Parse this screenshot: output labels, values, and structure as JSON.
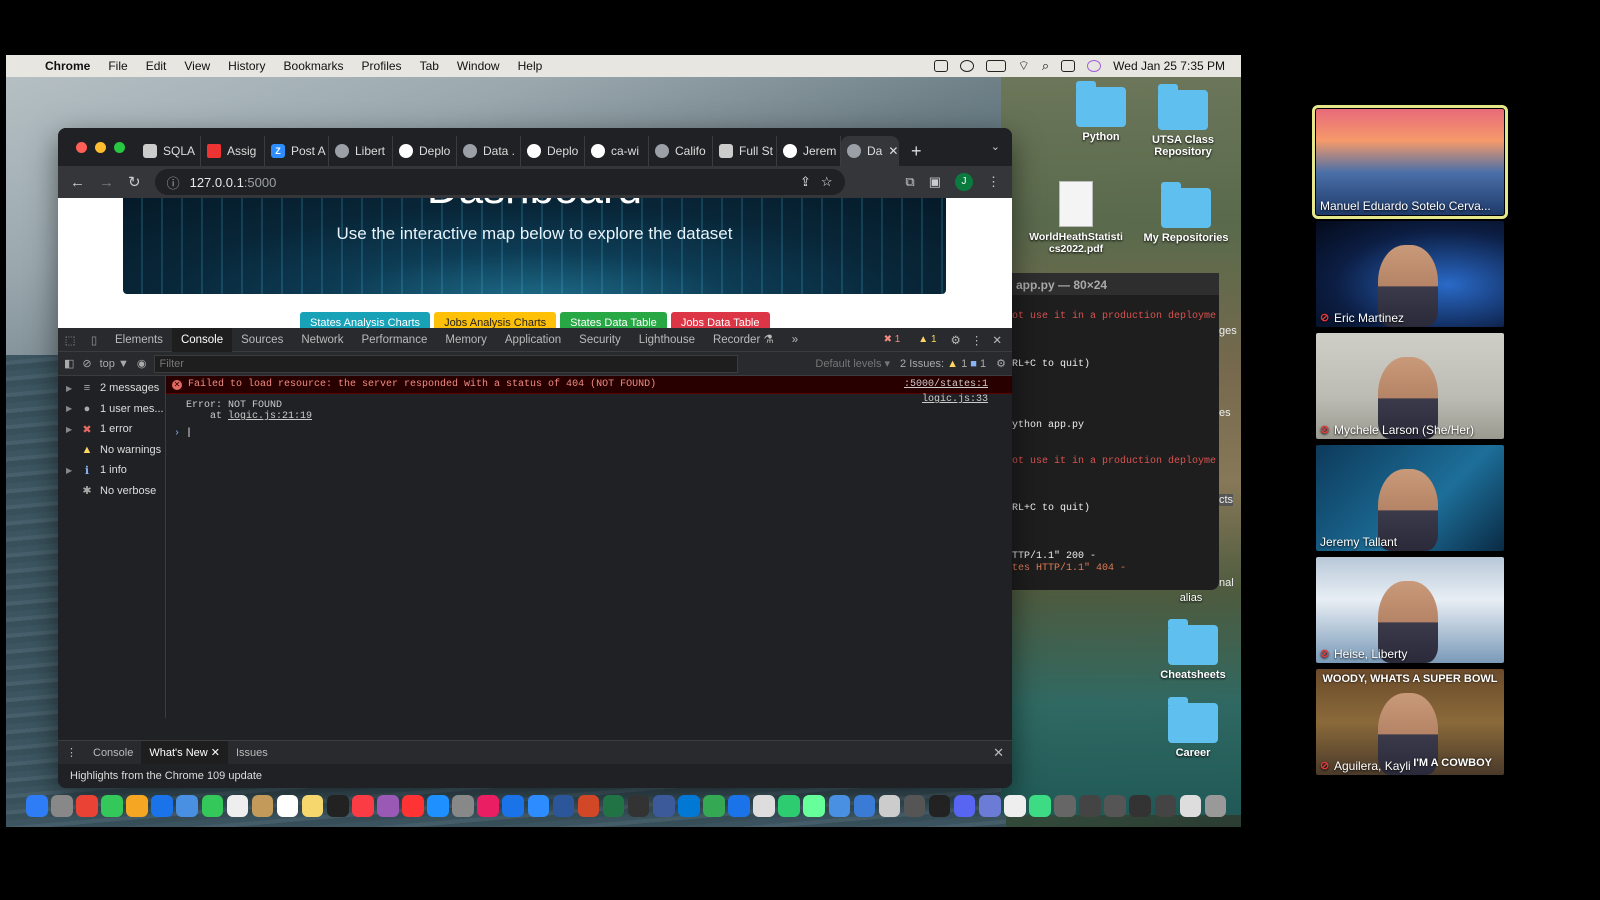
{
  "menubar": {
    "app": "Chrome",
    "items": [
      "File",
      "Edit",
      "View",
      "History",
      "Bookmarks",
      "Profiles",
      "Tab",
      "Window",
      "Help"
    ],
    "datetime": "Wed Jan 25  7:35 PM"
  },
  "desktop": {
    "icons": [
      {
        "label": "Python",
        "kind": "folder"
      },
      {
        "label": "UTSA Class Repository",
        "kind": "folder"
      },
      {
        "label": "WorldHeathStatistics2022.pdf",
        "kind": "doc"
      },
      {
        "label": "My Repositories",
        "kind": "folder"
      },
      {
        "label": "alias",
        "kind": "text"
      },
      {
        "label": "Cheatsheets",
        "kind": "folder"
      },
      {
        "label": "Career",
        "kind": "folder"
      }
    ],
    "edge_labels": [
      "ges",
      "es",
      "cts",
      "nal"
    ]
  },
  "terminal": {
    "title": "app.py — 80×24",
    "lines": [
      "ot use it in a production deployme",
      "RL+C to quit)",
      "ython app.py",
      "ot use it in a production deployme",
      "RL+C to quit)",
      "TTP/1.1\" 200 -",
      "tes HTTP/1.1\" 404 -"
    ]
  },
  "chrome": {
    "tabs": [
      {
        "label": "SQLA",
        "fav": "sq"
      },
      {
        "label": "Assig",
        "fav": "red"
      },
      {
        "label": "Post A",
        "fav": "z"
      },
      {
        "label": "Libert",
        "fav": "globe"
      },
      {
        "label": "Deplo",
        "fav": "gh"
      },
      {
        "label": "Data .",
        "fav": "globe"
      },
      {
        "label": "Deplo",
        "fav": "gh"
      },
      {
        "label": "ca-wi",
        "fav": "gh"
      },
      {
        "label": "Califo",
        "fav": "globe"
      },
      {
        "label": "Full St",
        "fav": "sq"
      },
      {
        "label": "Jerem",
        "fav": "gh"
      }
    ],
    "active_tab": "Da",
    "url": "127.0.0.1",
    "url_port": ":5000",
    "avatar_initial": "J"
  },
  "page": {
    "hero_title": "Dashboard",
    "hero_subtitle": "Use the interactive map below to explore the dataset",
    "buttons": [
      {
        "label": "States Analysis Charts",
        "color": "#17a2b8"
      },
      {
        "label": "Jobs Analysis Charts",
        "color": "#ffc107"
      },
      {
        "label": "States Data Table",
        "color": "#28a745"
      },
      {
        "label": "Jobs Data Table",
        "color": "#dc3545"
      }
    ]
  },
  "devtools": {
    "tabs": [
      "Elements",
      "Console",
      "Sources",
      "Network",
      "Performance",
      "Memory",
      "Application",
      "Security",
      "Lighthouse",
      "Recorder ⚗"
    ],
    "active_tab": "Console",
    "more": "»",
    "error_count": "1",
    "warn_count": "1",
    "context": "top ▼",
    "filter_placeholder": "Filter",
    "levels": "Default levels ▾",
    "issues_label": "2 Issues:",
    "issues_warn": "1",
    "issues_info": "1",
    "sidebar": [
      {
        "label": "2 messages",
        "icon": "≡",
        "color": "#aaa",
        "arrow": true
      },
      {
        "label": "1 user mes...",
        "icon": "●",
        "color": "#aaa",
        "arrow": true
      },
      {
        "label": "1 error",
        "icon": "✖",
        "color": "#e46962",
        "arrow": true
      },
      {
        "label": "No warnings",
        "icon": "▲",
        "color": "#fdd663",
        "arrow": false
      },
      {
        "label": "1 info",
        "icon": "ℹ",
        "color": "#8ab4f8",
        "arrow": true
      },
      {
        "label": "No verbose",
        "icon": "✱",
        "color": "#aaa",
        "arrow": false
      }
    ],
    "error_message": "Failed to load resource: the server responded with a status of 404 (NOT FOUND)",
    "error_source": ":5000/states:1",
    "error_detail": "Error: NOT FOUND",
    "error_at": "    at ",
    "error_at_link": "logic.js:21:19",
    "error_detail_source": "logic.js:33",
    "drawer_tabs": [
      "Console",
      "What's New",
      "Issues"
    ],
    "drawer_active": "What's New",
    "whats_new_text": "Highlights from the Chrome 109 update"
  },
  "dock_colors": [
    "#2e7cf6",
    "#888",
    "#ea4335",
    "#34c759",
    "#f5a623",
    "#1a73e8",
    "#4a90e2",
    "#34c759",
    "#eee",
    "#c49a5a",
    "#fff",
    "#f5d76e",
    "#222",
    "#fc3c44",
    "#9b59b6",
    "#f33",
    "#1e90ff",
    "#888",
    "#e91e63",
    "#1a73e8",
    "#2d8cff",
    "#2b579a",
    "#d24726",
    "#217346",
    "#333",
    "#3c5a99",
    "#0078d4",
    "#34a853",
    "#1a73e8",
    "#ddd",
    "#2ecc71",
    "#6f9",
    "#4a90e2",
    "#3a7bd5",
    "#ccc",
    "#555",
    "#222",
    "#5865f2",
    "#6b7bd6",
    "#eee",
    "#3ddc84",
    "#666",
    "#444",
    "#555",
    "#333",
    "#444",
    "#ddd",
    "#999"
  ],
  "participants": [
    {
      "name": "Manuel Eduardo Sotelo Cerva...",
      "muted": false,
      "active": true,
      "bg": "linear-gradient(180deg,#e86a7a 0%,#f59a6a 30%,#4a6fa8 60%,#1e3a6a 100%)"
    },
    {
      "name": "Eric Martinez",
      "muted": true,
      "active": false,
      "bg": "radial-gradient(ellipse at 70% 60%,#2a6ac8 0%,#0c1e44 60%,#040a1a 100%)"
    },
    {
      "name": "Mychele Larson (She/Her)",
      "muted": true,
      "active": false,
      "bg": "linear-gradient(180deg,#cfcfc8 0%,#bcbcb4 60%,#9a9a90 100%)"
    },
    {
      "name": "Jeremy Tallant",
      "muted": false,
      "active": false,
      "bg": "linear-gradient(135deg,#0d3a5a 0%,#1d6f9a 60%,#0a2a44 100%)"
    },
    {
      "name": "Heise, Liberty",
      "muted": true,
      "active": false,
      "bg": "linear-gradient(180deg,#b8c8d8 0%,#e8eef4 40%,#7a9ab8 100%)"
    },
    {
      "name": "Aguilera, Kayli",
      "muted": true,
      "active": false,
      "bg": "linear-gradient(180deg,#6a4a2a 0%,#8a6a3a 50%,#4a3a2a 100%)",
      "meme_top": "WOODY, WHATS A SUPER BOWL",
      "meme_bottom": "I'M A COWBOY"
    }
  ]
}
